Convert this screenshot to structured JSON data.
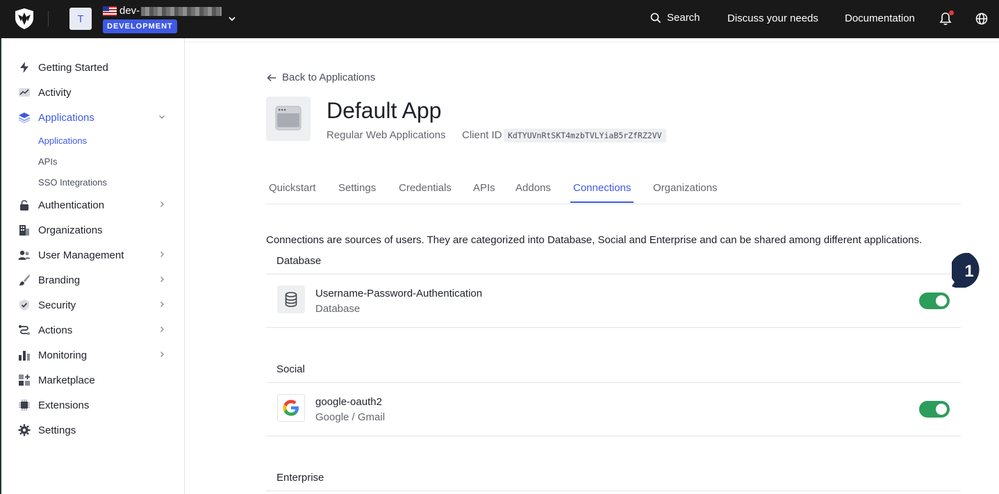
{
  "topbar": {
    "tenant_initial": "T",
    "tenant_name": "dev-",
    "environment_badge": "DEVELOPMENT",
    "search_label": "Search",
    "discuss_label": "Discuss your needs",
    "documentation_label": "Documentation"
  },
  "sidebar": {
    "items": [
      {
        "label": "Getting Started",
        "icon": "lightning-icon"
      },
      {
        "label": "Activity",
        "icon": "activity-chart-icon"
      },
      {
        "label": "Applications",
        "icon": "layers-icon"
      },
      {
        "label": "Authentication",
        "icon": "lock-icon"
      },
      {
        "label": "Organizations",
        "icon": "building-icon"
      },
      {
        "label": "User Management",
        "icon": "users-icon"
      },
      {
        "label": "Branding",
        "icon": "brush-icon"
      },
      {
        "label": "Security",
        "icon": "shield-check-icon"
      },
      {
        "label": "Actions",
        "icon": "actions-flow-icon"
      },
      {
        "label": "Monitoring",
        "icon": "bar-chart-icon"
      },
      {
        "label": "Marketplace",
        "icon": "grid-plus-icon"
      },
      {
        "label": "Extensions",
        "icon": "chip-icon"
      },
      {
        "label": "Settings",
        "icon": "gear-icon"
      }
    ],
    "applications_sub": [
      "Applications",
      "APIs",
      "SSO Integrations"
    ]
  },
  "page": {
    "back_link": "Back to Applications",
    "app_title": "Default App",
    "app_type": "Regular Web Applications",
    "client_id_label": "Client ID",
    "client_id_value": "KdTYUVnRtSKT4mzbTVLYiaB5rZfRZ2VV",
    "tabs": [
      "Quickstart",
      "Settings",
      "Credentials",
      "APIs",
      "Addons",
      "Connections",
      "Organizations"
    ],
    "active_tab": "Connections",
    "intro_text": "Connections are sources of users. They are categorized into Database, Social and Enterprise and can be shared among different applications."
  },
  "sections": {
    "database": {
      "title": "Database",
      "connection": {
        "name": "Username-Password-Authentication",
        "type": "Database",
        "enabled": true
      }
    },
    "social": {
      "title": "Social",
      "connection": {
        "name": "google-oauth2",
        "type": "Google / Gmail",
        "enabled": true
      }
    },
    "enterprise": {
      "title": "Enterprise"
    }
  },
  "annotation_badge": "1",
  "colors": {
    "accent": "#3f59e4",
    "toggle_on": "#2d9d5b",
    "topbar": "#191919"
  }
}
